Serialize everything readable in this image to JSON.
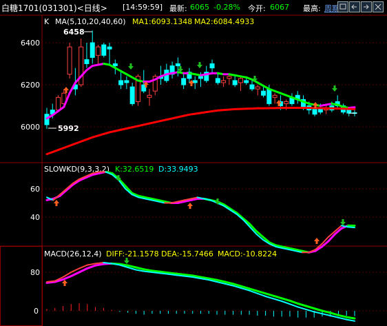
{
  "header": {
    "title": "白糖1701(031301)<日线>",
    "time": "[14:59:59]",
    "latest_label": "最新:",
    "latest_value": "6065",
    "change": "-0.28%",
    "open_label": "今开:",
    "open_value": "6067",
    "high_label": "最高:",
    "period_label": "周期",
    "buttons": [
      "restore-icon",
      "left-arrow-icon",
      "right-arrow-icon",
      "close-icon"
    ]
  },
  "colors": {
    "background": "#000000",
    "axis": "#8b0000",
    "grid": "#3a0000",
    "up": "#ff4040",
    "down": "#00ffff",
    "ma1": "#ff00ff",
    "ma1_alt": "#00ff00",
    "ma2": "#ff0000",
    "k_line": "#00ffff",
    "d_line_a": "#ff00ff",
    "d_line_b": "#00ff00",
    "diff": "#00ffff",
    "dea": "#ff00ff",
    "yellow": "#ffff00",
    "blue": "#3c5aff",
    "macd_pos": "#ff2020",
    "macd_neg": "#00ffff",
    "buy_arrow": "#ff6020",
    "sell_arrow": "#20c020"
  },
  "chart_data": [
    {
      "type": "candlestick",
      "legend_prefix": "K",
      "legend_ma": "MA(5,10,20,40,60)",
      "legend_ma1": "MA1:6093.1348",
      "legend_ma2": "MA2:6084.4933",
      "yticks": [
        6400,
        6200,
        6000
      ],
      "ylim": [
        5800,
        6500
      ],
      "annotations": {
        "high": "6458",
        "low": "5992"
      },
      "candles": [
        [
          6060,
          6090,
          5990,
          6010
        ],
        [
          6080,
          6110,
          6040,
          6060
        ],
        [
          6080,
          6150,
          6070,
          6140
        ],
        [
          6110,
          6180,
          6090,
          6160
        ],
        [
          6250,
          6400,
          6230,
          6380
        ],
        [
          6200,
          6280,
          6150,
          6180
        ],
        [
          6200,
          6420,
          6190,
          6380
        ],
        [
          6320,
          6400,
          6280,
          6300
        ],
        [
          6400,
          6458,
          6300,
          6330
        ],
        [
          6340,
          6390,
          6300,
          6380
        ],
        [
          6390,
          6400,
          6330,
          6340
        ],
        [
          6380,
          6400,
          6300,
          6370
        ],
        [
          6300,
          6320,
          6250,
          6290
        ],
        [
          6220,
          6260,
          6180,
          6200
        ],
        [
          6220,
          6240,
          6180,
          6210
        ],
        [
          6190,
          6210,
          6100,
          6110
        ],
        [
          6120,
          6250,
          6100,
          6240
        ],
        [
          6200,
          6270,
          6160,
          6170
        ],
        [
          6140,
          6180,
          6100,
          6150
        ],
        [
          6170,
          6250,
          6150,
          6240
        ],
        [
          6240,
          6290,
          6200,
          6230
        ],
        [
          6270,
          6300,
          6210,
          6220
        ],
        [
          6290,
          6310,
          6230,
          6250
        ],
        [
          6300,
          6330,
          6240,
          6290
        ],
        [
          6230,
          6260,
          6180,
          6200
        ],
        [
          6260,
          6280,
          6210,
          6230
        ],
        [
          6220,
          6240,
          6180,
          6210
        ],
        [
          6240,
          6260,
          6190,
          6230
        ],
        [
          6260,
          6290,
          6210,
          6220
        ],
        [
          6300,
          6320,
          6250,
          6280
        ],
        [
          6230,
          6260,
          6200,
          6210
        ],
        [
          6210,
          6240,
          6190,
          6220
        ],
        [
          6230,
          6250,
          6200,
          6240
        ],
        [
          6220,
          6240,
          6190,
          6200
        ],
        [
          6210,
          6240,
          6170,
          6230
        ],
        [
          6220,
          6240,
          6200,
          6210
        ],
        [
          6200,
          6220,
          6170,
          6180
        ],
        [
          6180,
          6200,
          6150,
          6190
        ],
        [
          6170,
          6200,
          6140,
          6150
        ],
        [
          6180,
          6200,
          6100,
          6110
        ],
        [
          6140,
          6160,
          6110,
          6150
        ],
        [
          6120,
          6150,
          6080,
          6100
        ],
        [
          6110,
          6130,
          6080,
          6120
        ],
        [
          6140,
          6160,
          6100,
          6110
        ],
        [
          6150,
          6170,
          6110,
          6130
        ],
        [
          6130,
          6150,
          6080,
          6090
        ],
        [
          6100,
          6120,
          6060,
          6080
        ],
        [
          6090,
          6110,
          6050,
          6060
        ],
        [
          6090,
          6110,
          6060,
          6070
        ],
        [
          6080,
          6100,
          6060,
          6090
        ],
        [
          6100,
          6120,
          6070,
          6080
        ],
        [
          6120,
          6150,
          6090,
          6100
        ],
        [
          6100,
          6110,
          6060,
          6070
        ],
        [
          6080,
          6090,
          6050,
          6065
        ],
        [
          6067,
          6080,
          6050,
          6065
        ]
      ],
      "ma1": [
        6040,
        6055,
        6075,
        6095,
        6160,
        6210,
        6240,
        6270,
        6290,
        6295,
        6300,
        6295,
        6280,
        6265,
        6250,
        6235,
        6220,
        6215,
        6215,
        6225,
        6240,
        6250,
        6255,
        6260,
        6255,
        6255,
        6250,
        6245,
        6250,
        6255,
        6255,
        6250,
        6250,
        6245,
        6240,
        6235,
        6225,
        6210,
        6195,
        6180,
        6170,
        6160,
        6150,
        6140,
        6130,
        6120,
        6110,
        6105,
        6100,
        6105,
        6110,
        6105,
        6095,
        6090,
        6093
      ],
      "ma2": [
        5870,
        5880,
        5890,
        5900,
        5910,
        5920,
        5930,
        5940,
        5950,
        5958,
        5966,
        5974,
        5980,
        5986,
        5992,
        5998,
        6004,
        6010,
        6016,
        6022,
        6028,
        6034,
        6040,
        6046,
        6052,
        6058,
        6062,
        6066,
        6070,
        6074,
        6078,
        6080,
        6082,
        6084,
        6085,
        6086,
        6087,
        6088,
        6088,
        6089,
        6089,
        6090,
        6090,
        6090,
        6090,
        6090,
        6090,
        6089,
        6089,
        6088,
        6088,
        6087,
        6086,
        6085,
        6084
      ]
    },
    {
      "type": "line",
      "legend_name": "SLOWKD(9,3,3,2)",
      "legend_k": "K:32.6519",
      "legend_d": "D:33.9493",
      "yticks": [
        60,
        40
      ],
      "ylim": [
        5,
        78
      ],
      "k": [
        54,
        52,
        56,
        60,
        64,
        67,
        69,
        71,
        72,
        72,
        70,
        66,
        60,
        56,
        54,
        53,
        52,
        51,
        50,
        50,
        51,
        52,
        53,
        54,
        53,
        52,
        50,
        48,
        45,
        42,
        38,
        33,
        28,
        24,
        21,
        19,
        18,
        17,
        16,
        15,
        15,
        17,
        21,
        26,
        30,
        34,
        33,
        32.65
      ],
      "d": [
        52,
        53,
        55,
        59,
        63,
        66,
        68,
        70,
        71,
        72,
        71,
        67,
        62,
        57,
        55,
        54,
        53,
        52,
        51,
        50,
        50,
        51,
        52,
        53,
        53,
        52,
        51,
        49,
        46,
        43,
        39,
        35,
        30,
        26,
        22,
        20,
        19,
        18,
        17,
        16,
        15,
        16,
        19,
        23,
        28,
        32,
        34,
        33.95
      ]
    },
    {
      "type": "line+bar",
      "legend_name": "MACD(26,12,4)",
      "legend_diff": "DIFF:-21.1578",
      "legend_dea": "DEA:-15.7466",
      "legend_macd": "MACD:-10.8224",
      "yticks": [
        80,
        0
      ],
      "ylim": [
        -30,
        120
      ],
      "diff": [
        60,
        62,
        70,
        80,
        88,
        95,
        98,
        100,
        98,
        95,
        90,
        85,
        82,
        80,
        78,
        76,
        74,
        72,
        70,
        67,
        64,
        60,
        56,
        52,
        47,
        42,
        36,
        30,
        25,
        20,
        14,
        8,
        3,
        -2,
        -6,
        -10,
        -14,
        -18,
        -21.16
      ],
      "dea": [
        58,
        60,
        65,
        72,
        80,
        88,
        94,
        97,
        98,
        97,
        94,
        90,
        86,
        83,
        81,
        79,
        77,
        75,
        73,
        70,
        67,
        64,
        60,
        56,
        51,
        46,
        41,
        36,
        31,
        26,
        21,
        15,
        10,
        5,
        0,
        -4,
        -9,
        -13,
        -15.75
      ],
      "macd": [
        4,
        6,
        10,
        14,
        16,
        14,
        8,
        6,
        2,
        -2,
        -4,
        -6,
        -8,
        -6,
        -6,
        -6,
        -6,
        -6,
        -6,
        -6,
        -6,
        -8,
        -8,
        -8,
        -8,
        -8,
        -10,
        -10,
        -12,
        -12,
        -12,
        -14,
        -14,
        -14,
        -12,
        -12,
        -10,
        -10,
        -10.82
      ]
    }
  ]
}
